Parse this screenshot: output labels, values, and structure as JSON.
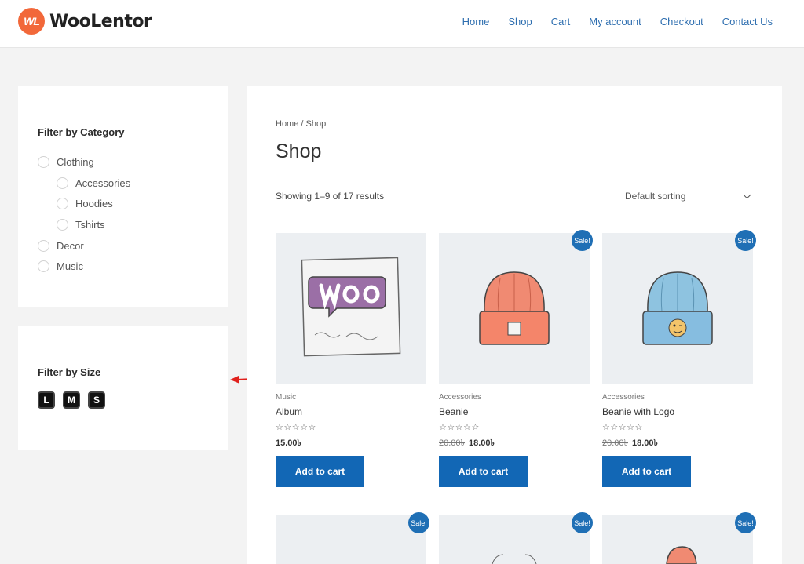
{
  "header": {
    "logo_badge": "WL",
    "logo_text": "WooLentor",
    "nav": [
      "Home",
      "Shop",
      "Cart",
      "My account",
      "Checkout",
      "Contact Us"
    ]
  },
  "sidebar": {
    "category_title": "Filter by Category",
    "categories": [
      {
        "label": "Clothing",
        "level": 0
      },
      {
        "label": "Accessories",
        "level": 1
      },
      {
        "label": "Hoodies",
        "level": 1
      },
      {
        "label": "Tshirts",
        "level": 1
      },
      {
        "label": "Decor",
        "level": 0
      },
      {
        "label": "Music",
        "level": 0
      }
    ],
    "size_title": "Filter by Size",
    "sizes": [
      "L",
      "M",
      "S"
    ]
  },
  "main": {
    "breadcrumb_home": "Home",
    "breadcrumb_separator": " / ",
    "breadcrumb_current": "Shop",
    "title": "Shop",
    "result_count": "Showing 1–9 of 17 results",
    "sorting": "Default sorting",
    "sale_badge": "Sale!",
    "add_to_cart": "Add to cart",
    "stars": "☆☆☆☆☆",
    "products": [
      {
        "category": "Music",
        "title": "Album",
        "price": "15.00৳",
        "old_price": "",
        "sale": false,
        "image": "album"
      },
      {
        "category": "Accessories",
        "title": "Beanie",
        "price": "18.00৳",
        "old_price": "20.00৳",
        "sale": true,
        "image": "beanie"
      },
      {
        "category": "Accessories",
        "title": "Beanie with Logo",
        "price": "18.00৳",
        "old_price": "20.00৳",
        "sale": true,
        "image": "beanie-logo"
      }
    ],
    "second_row_sale": [
      true,
      true,
      true
    ]
  },
  "colors": {
    "accent": "#1267b5",
    "brand": "#f2683a",
    "annotation": "#e0201c"
  }
}
